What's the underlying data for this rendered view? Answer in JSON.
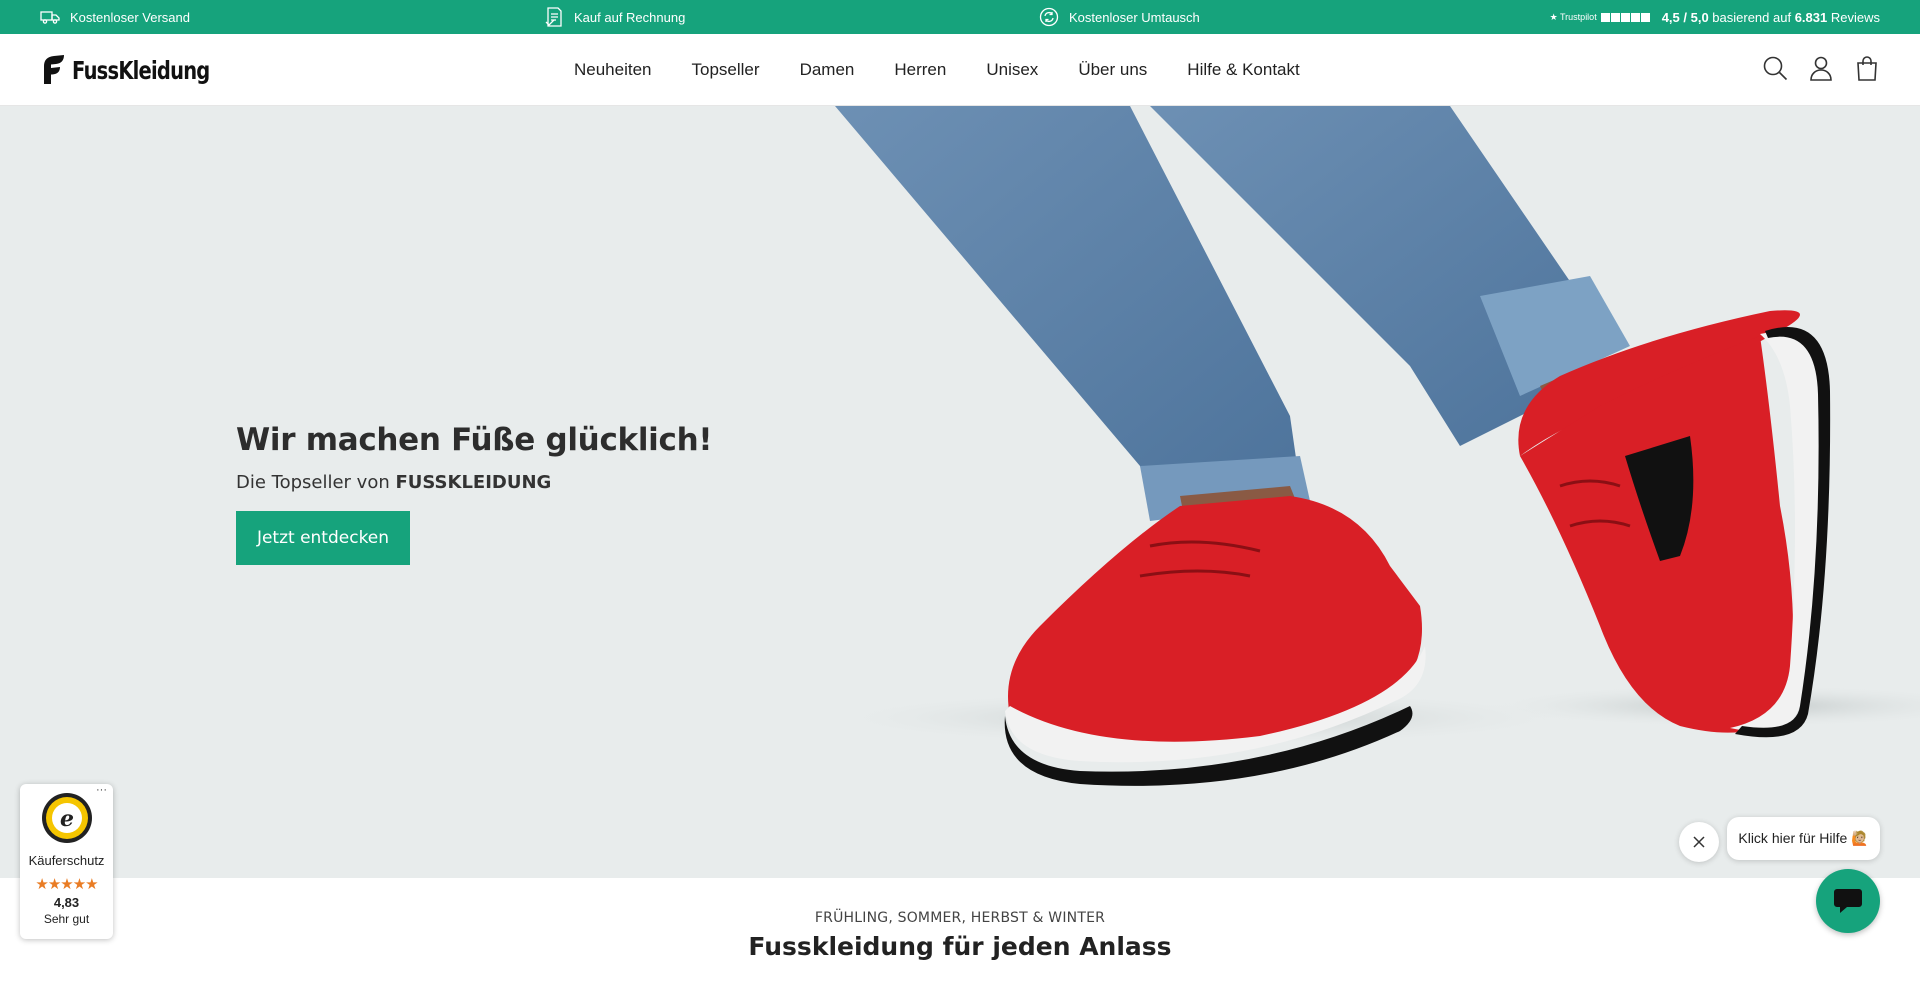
{
  "topbar": {
    "shipping": "Kostenloser Versand",
    "invoice": "Kauf auf Rechnung",
    "exchange": "Kostenloser Umtausch",
    "trustpilot_logo": "Trustpilot",
    "rating_score": "4,5 / 5,0",
    "rating_mid": " basierend auf ",
    "rating_count": "6.831",
    "rating_end": " Reviews"
  },
  "header": {
    "logo_text": "FussKleidung",
    "nav": [
      "Neuheiten",
      "Topseller",
      "Damen",
      "Herren",
      "Unisex",
      "Über uns",
      "Hilfe & Kontakt"
    ],
    "icons": [
      "search-icon",
      "account-icon",
      "cart-icon"
    ]
  },
  "hero": {
    "title": "Wir machen Füße glücklich!",
    "subtitle_prefix": "Die Topseller von ",
    "subtitle_brand": "FUSSKLEIDUNG",
    "cta": "Jetzt entdecken"
  },
  "section": {
    "eyebrow": "FRÜHLING, SOMMER, HERBST & WINTER",
    "title": "Fusskleidung für jeden Anlass"
  },
  "trusted_shops": {
    "more": "···",
    "label": "Käuferschutz",
    "stars": "★★★★★",
    "score": "4,83",
    "grade": "Sehr gut"
  },
  "chat": {
    "bubble": "Klick hier für Hilfe 🙋🏼"
  },
  "colors": {
    "brand_green": "#16a37c",
    "shoe_red": "#d91f26",
    "jeans_blue": "#5a7fa5",
    "hero_bg": "#e8ecec"
  }
}
